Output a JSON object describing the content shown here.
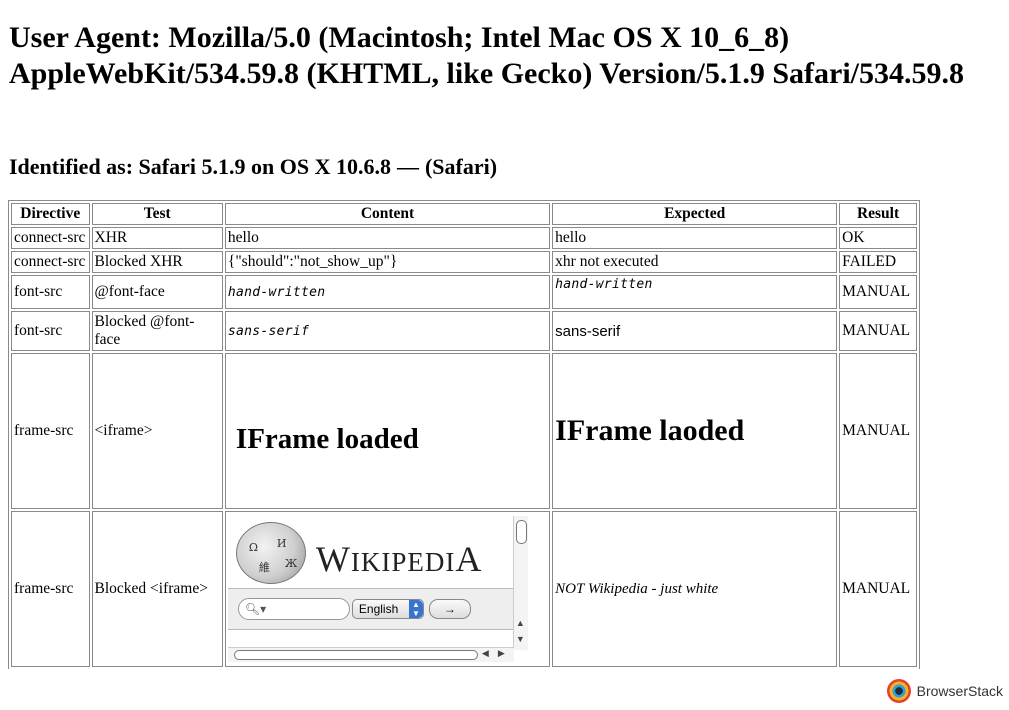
{
  "header": {
    "user_agent": "User Agent: Mozilla/5.0 (Macintosh; Intel Mac OS X 10_6_8) AppleWebKit/534.59.8 (KHTML, like Gecko) Version/5.1.9 Safari/534.59.8",
    "identified_prefix": "Identified as: Safari 5.1.9 on OS X 10.6.8",
    "identified_dash": "—",
    "identified_suffix": "(Safari)"
  },
  "table": {
    "headers": [
      "Directive",
      "Test",
      "Content",
      "Expected",
      "Result"
    ],
    "rows": [
      [
        "connect-src",
        "XHR",
        "hello",
        "hello",
        "OK"
      ],
      [
        "connect-src",
        "Blocked XHR",
        "{\"should\":\"not_show_up\"}",
        "xhr not executed",
        "FAILED"
      ],
      [
        "font-src",
        "@font-face",
        "hand-written",
        "hand-written",
        "MANUAL"
      ],
      [
        "font-src",
        "Blocked @font-face",
        "sans-serif",
        "sans-serif",
        "MANUAL"
      ],
      [
        "frame-src",
        "<iframe>",
        "IFrame loaded",
        "IFrame laoded",
        "MANUAL"
      ],
      [
        "frame-src",
        "Blocked <iframe>",
        "",
        "NOT Wikipedia - just white",
        "MANUAL"
      ]
    ]
  },
  "wikipedia": {
    "wordmark_first": "W",
    "wordmark_rest": "IKIPEDI",
    "wordmark_last": "A",
    "language": "English",
    "go_arrow": "→",
    "globe_glyphs": [
      "Ω",
      "И",
      "維",
      "Ж"
    ]
  },
  "badge": {
    "label": "BrowserStack"
  }
}
